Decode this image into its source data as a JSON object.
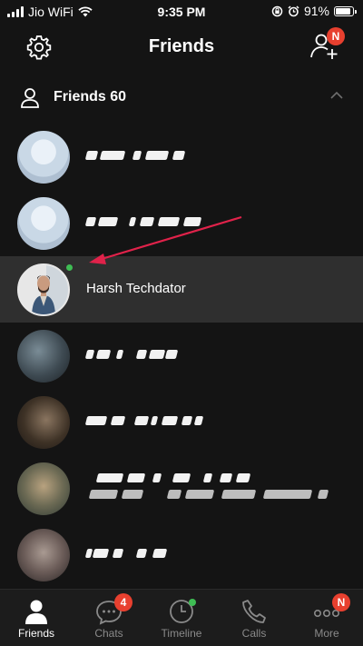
{
  "status_bar": {
    "carrier": "Jio WiFi",
    "time": "9:35 PM",
    "battery": "91%",
    "battery_level": 0.91
  },
  "header": {
    "title": "Friends",
    "add_friend_badge": "N",
    "icons": [
      "gear-icon",
      "add-friend-icon"
    ]
  },
  "section": {
    "title": "Friends 60",
    "icon": "person-icon",
    "collapse_icon": "chevron-up-icon"
  },
  "friends": [
    {
      "name": "",
      "obscured": true,
      "online": false,
      "avatar": "default"
    },
    {
      "name": "",
      "obscured": true,
      "online": false,
      "avatar": "default"
    },
    {
      "name": "Harsh Techdator",
      "obscured": false,
      "online": true,
      "highlighted": true,
      "avatar": "photo"
    },
    {
      "name": "",
      "obscured": true,
      "online": false,
      "avatar": "photo"
    },
    {
      "name": "",
      "obscured": true,
      "online": false,
      "avatar": "photo"
    },
    {
      "name": "",
      "obscured": true,
      "online": false,
      "avatar": "photo"
    },
    {
      "name": "",
      "obscured": true,
      "online": false,
      "avatar": "photo"
    }
  ],
  "tabs": [
    {
      "label": "Friends",
      "icon": "person-icon",
      "active": true
    },
    {
      "label": "Chats",
      "icon": "chat-bubble-icon",
      "badge": "4"
    },
    {
      "label": "Timeline",
      "icon": "clock-icon",
      "dot": true
    },
    {
      "label": "Calls",
      "icon": "phone-icon"
    },
    {
      "label": "More",
      "icon": "more-dots-icon",
      "badge": "N"
    }
  ],
  "colors": {
    "background": "#141414",
    "highlight_row": "#2f2f2f",
    "badge_red": "#e8402f",
    "online_green": "#3fbd54",
    "annotation_arrow": "#e0224a"
  }
}
